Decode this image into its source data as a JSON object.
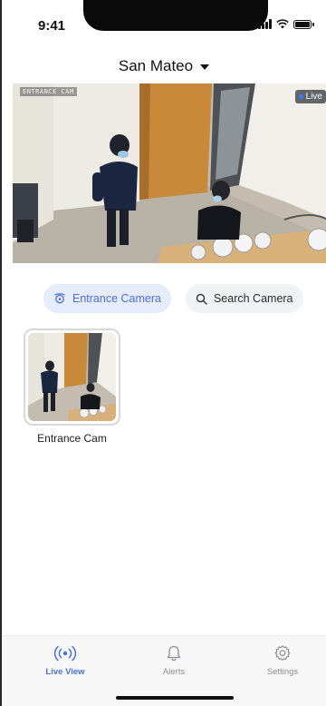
{
  "status_bar": {
    "time": "9:41"
  },
  "header": {
    "location": "San Mateo"
  },
  "main_video": {
    "overlay_label": "ENTRANCE CAM",
    "live_label": "Live"
  },
  "chips": {
    "entrance": "Entrance Camera",
    "search": "Search Camera"
  },
  "cameras": [
    {
      "name": "Entrance Cam"
    }
  ],
  "bottom_nav": {
    "live_view": "Live View",
    "alerts": "Alerts",
    "settings": "Settings"
  },
  "colors": {
    "accent": "#4a6fd8",
    "chip_active_bg": "#e6ecfb",
    "chip_bg": "#f1f2f4",
    "nav_bg": "#f7f7f8",
    "live_dot": "#3b7bff"
  },
  "icons": {
    "entrance_chip": "camera-icon",
    "search_chip": "search-icon",
    "live_view": "live-broadcast-icon",
    "alerts": "bell-icon",
    "settings": "gear-icon",
    "location": "chevron-down-icon"
  }
}
